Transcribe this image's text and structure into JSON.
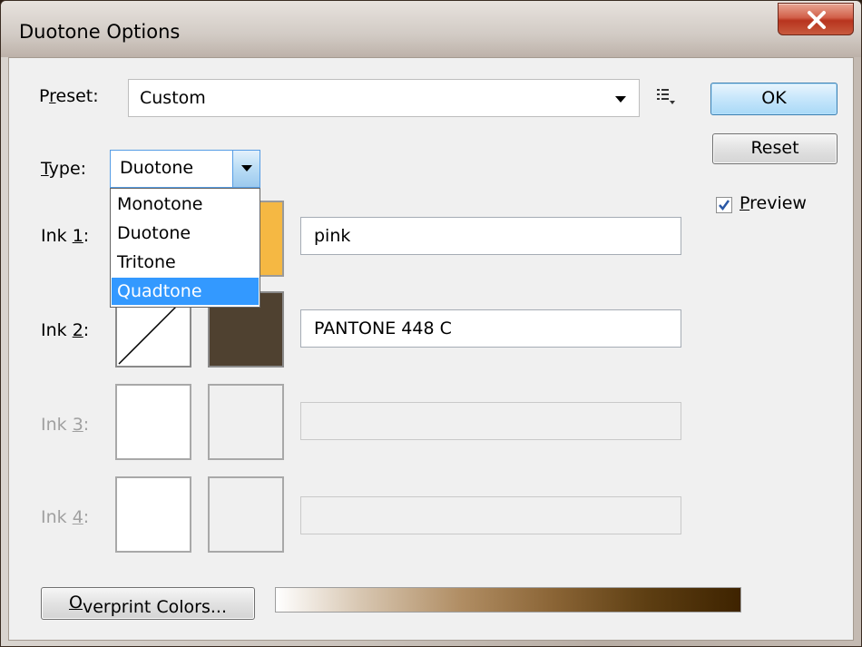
{
  "window": {
    "title": "Duotone Options",
    "close_glyph": "x"
  },
  "preset": {
    "label_pre": "P",
    "label_accel": "r",
    "label_post": "eset:",
    "value": "Custom",
    "menu_icon": "list-options-icon"
  },
  "type": {
    "label_accel": "T",
    "label_post": "ype:",
    "value": "Duotone",
    "options": [
      "Monotone",
      "Duotone",
      "Tritone",
      "Quadtone"
    ],
    "highlighted": "Quadtone"
  },
  "inks": [
    {
      "label_pre": "Ink ",
      "label_accel": "1",
      "label_post": ":",
      "color": "#f5b843",
      "name": "pink",
      "enabled": true
    },
    {
      "label_pre": "Ink ",
      "label_accel": "2",
      "label_post": ":",
      "color": "#4f4130",
      "name": "PANTONE 448 C",
      "enabled": true
    },
    {
      "label_pre": "Ink ",
      "label_accel": "3",
      "label_post": ":",
      "color": "",
      "name": "",
      "enabled": false
    },
    {
      "label_pre": "Ink ",
      "label_accel": "4",
      "label_post": ":",
      "color": "",
      "name": "",
      "enabled": false
    }
  ],
  "buttons": {
    "ok": "OK",
    "reset": "Reset",
    "overprint_accel": "O",
    "overprint_post": "verprint Colors..."
  },
  "preview": {
    "label_accel": "P",
    "label_post": "review",
    "checked": true
  },
  "gradient": {
    "start_color": "#ffffff",
    "end_color": "#3e2300"
  }
}
